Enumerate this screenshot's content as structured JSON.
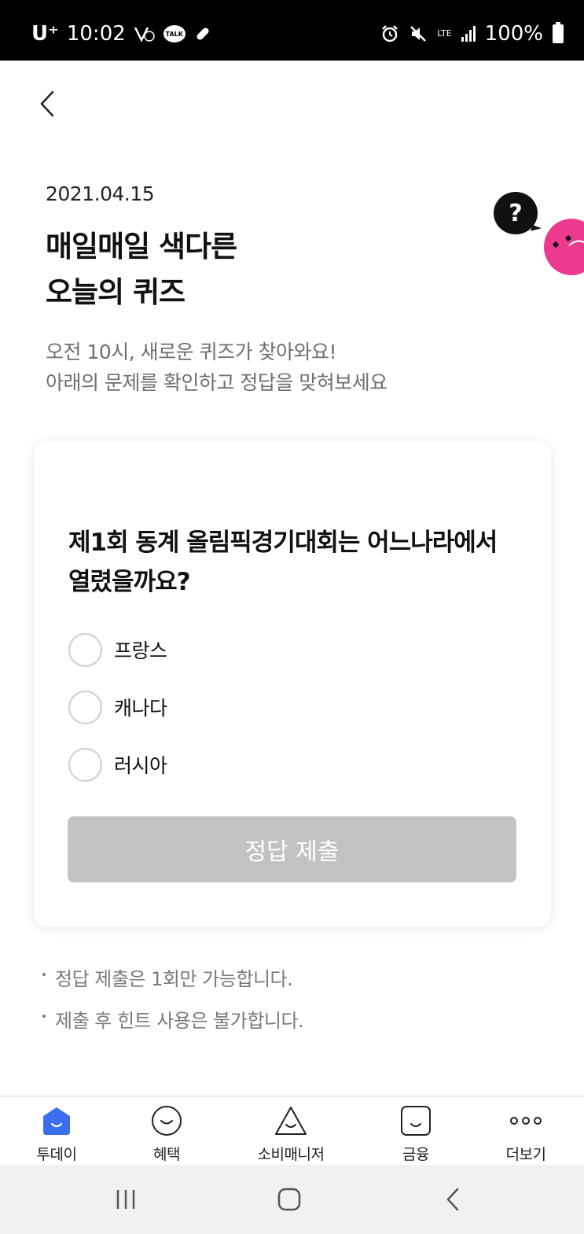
{
  "status_bar": {
    "carrier": "U⁺",
    "time": "10:02",
    "talk_label": "TALK",
    "network": "LTE",
    "battery": "100%",
    "icons": [
      "wifi-call-icon",
      "talk-icon",
      "pill-icon",
      "alarm-icon",
      "mute-icon",
      "lte-icon",
      "signal-icon",
      "battery-icon"
    ]
  },
  "header": {
    "date": "2021.04.15",
    "title_line1": "매일매일 색다른",
    "title_line2": "오늘의 퀴즈",
    "subtitle_line1": "오전 10시, 새로운 퀴즈가 찾아와요!",
    "subtitle_line2": "아래의 문제를 확인하고 정답을 맞혀보세요"
  },
  "illustration": {
    "bubble_text": "?",
    "mascot_color": "#ec3b8e"
  },
  "quiz": {
    "question": "제1회 동계 올림픽경기대회는 어느나라에서 열렸을까요?",
    "options": [
      "프랑스",
      "캐나다",
      "러시아"
    ],
    "submit_label": "정답 제출",
    "submit_color": "#c2c2c2"
  },
  "notes": [
    "정답 제출은 1회만 가능합니다.",
    "제출 후 힌트 사용은 불가합니다."
  ],
  "bottom_nav": {
    "active_color": "#3b6ff0",
    "items": [
      {
        "label": "투데이",
        "icon": "home-icon"
      },
      {
        "label": "혜택",
        "icon": "smile-icon"
      },
      {
        "label": "소비매니저",
        "icon": "triangle-icon"
      },
      {
        "label": "금융",
        "icon": "wallet-icon"
      },
      {
        "label": "더보기",
        "icon": "more-icon"
      }
    ]
  },
  "system_nav": {
    "icons": [
      "recent-apps-icon",
      "home-button-icon",
      "back-nav-icon"
    ]
  }
}
